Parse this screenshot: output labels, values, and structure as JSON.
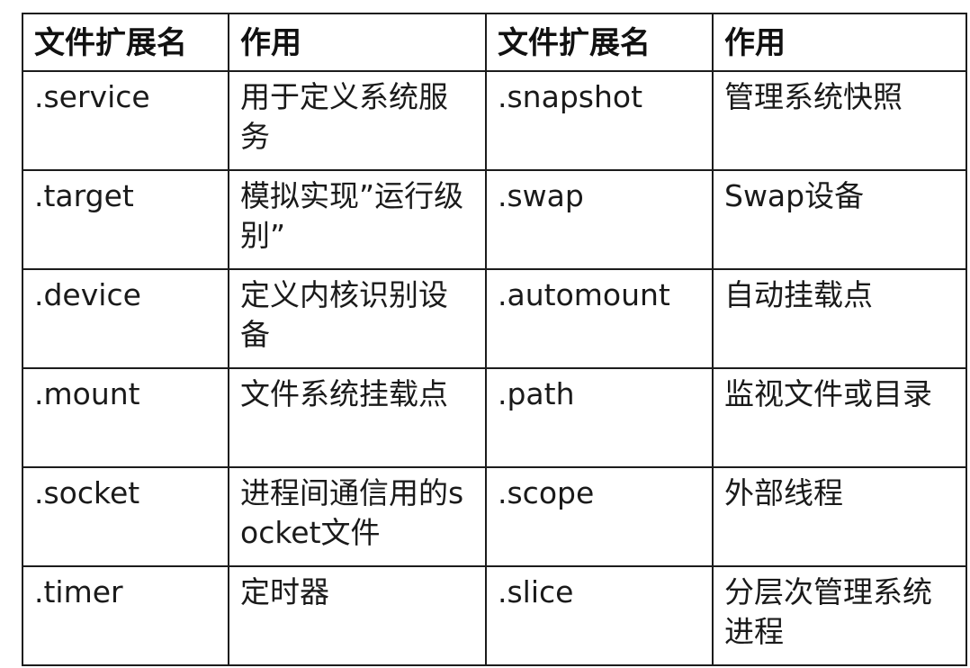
{
  "headers": [
    "文件扩展名",
    "作用",
    "文件扩展名",
    "作用"
  ],
  "rows": [
    [
      ".service",
      "用于定义系统服务",
      ".snapshot",
      "管理系统快照"
    ],
    [
      ".target",
      "模拟实现”运行级别”",
      ".swap",
      "Swap设备"
    ],
    [
      ".device",
      "定义内核识别设备",
      ".automount",
      "自动挂载点"
    ],
    [
      ".mount",
      "文件系统挂载点",
      ".path",
      "监视文件或目录"
    ],
    [
      ".socket",
      "进程间通信用的socket文件",
      ".scope",
      "外部线程"
    ],
    [
      ".timer",
      "定时器",
      ".slice",
      "分层次管理系统进程"
    ]
  ],
  "colors": {
    "highlight_text": "#a50d0d",
    "default_text": "#1a1a1a",
    "border": "#1c1c1c"
  }
}
